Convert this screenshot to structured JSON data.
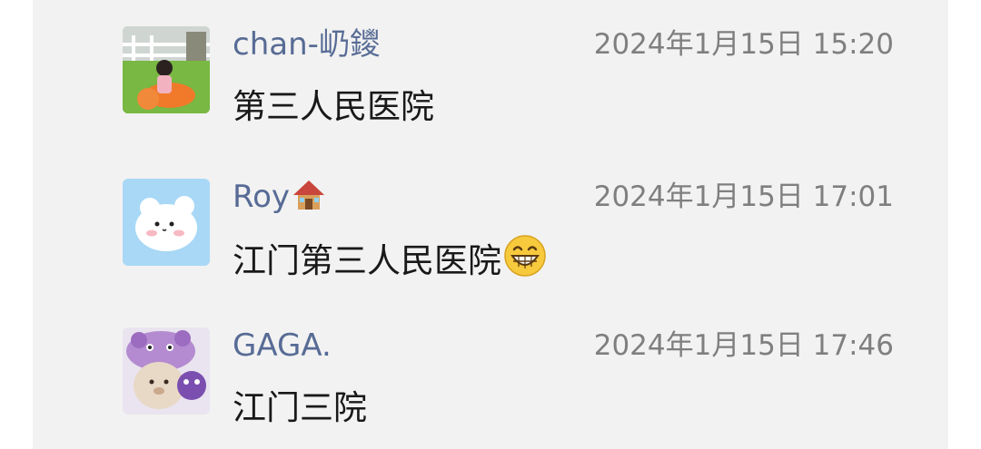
{
  "comments": [
    {
      "avatar_icon": "child-playground-avatar-icon",
      "author": "chan-屷鑁",
      "time": "2024年1月15日 15:20",
      "text": "第三人民医院"
    },
    {
      "avatar_icon": "white-bear-avatar-icon",
      "author": "Roy",
      "author_emoji": "house-emoji-icon",
      "time": "2024年1月15日 17:01",
      "text": "江门第三人民医院",
      "text_emoji": "grinning-face-emoji-icon"
    },
    {
      "avatar_icon": "purple-hat-bear-avatar-icon",
      "author": "GAGA.",
      "time": "2024年1月15日 17:46",
      "text": "江门三院"
    }
  ],
  "colors": {
    "background": "#f2f2f2",
    "author": "#576b95",
    "time": "#7f7f7f",
    "text": "#191919"
  }
}
